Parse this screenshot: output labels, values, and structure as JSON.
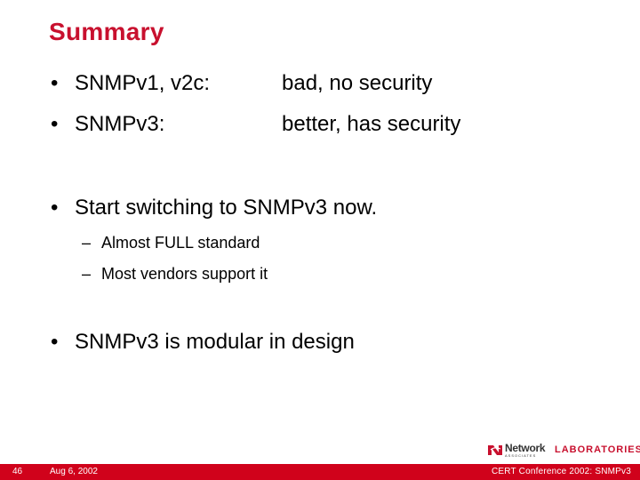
{
  "slide": {
    "title": "Summary",
    "comparison": [
      {
        "bullet": "•",
        "label": "SNMPv1, v2c:",
        "value": "bad, no security"
      },
      {
        "bullet": "•",
        "label": "SNMPv3:",
        "value": "better, has security"
      }
    ],
    "points": [
      {
        "bullet": "•",
        "text": "Start switching to SNMPv3 now.",
        "subpoints": [
          {
            "dash": "–",
            "text": "Almost FULL standard"
          },
          {
            "dash": "–",
            "text": "Most vendors support it"
          }
        ]
      },
      {
        "bullet": "•",
        "text": "SNMPv3 is modular in design",
        "subpoints": []
      }
    ]
  },
  "logo": {
    "company": "Network",
    "company_sub": "ASSOCIATES",
    "division": "LABORATORIES"
  },
  "footer": {
    "slide_number": "46",
    "date": "Aug 6, 2002",
    "conference": "CERT Conference 2002: SNMPv3"
  },
  "colors": {
    "accent": "#c8102e",
    "footer_bar": "#d0021b"
  }
}
